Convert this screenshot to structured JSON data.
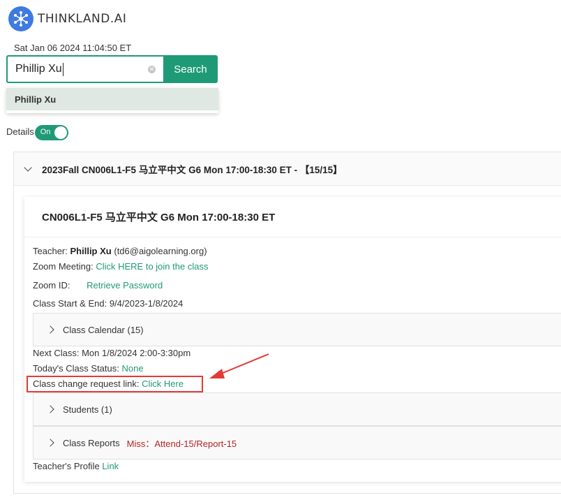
{
  "brand": {
    "name": "THINKLAND.AI",
    "logo_icon": "network-nodes-icon",
    "color": "#3f7ae0"
  },
  "datetime": "Sat Jan 06 2024 11:04:50 ET",
  "search": {
    "value": "Phillip Xu",
    "button_label": "Search",
    "clear_icon": "clear-icon",
    "accent": "#1f9a76"
  },
  "suggestion": {
    "item": "Phillip Xu"
  },
  "details": {
    "label": "Details",
    "toggle_label": "On",
    "state": true
  },
  "course": {
    "header": "2023Fall CN006L1-F5 马立平中文 G6 Mon 17:00-18:30 ET - 【15/15】",
    "title": "CN006L1-F5 马立平中文 G6 Mon 17:00-18:30 ET",
    "teacher_label": "Teacher:",
    "teacher_name": "Phillip Xu",
    "teacher_email": "(td6@aigolearning.org)",
    "zoom_meeting_label": "Zoom Meeting:",
    "zoom_meeting_link": "Click HERE to join the class",
    "zoom_id_label": "Zoom ID:",
    "zoom_id_link": "Retrieve Password",
    "start_end": "Class Start & End: 9/4/2023-1/8/2024",
    "calendar_label": "Class Calendar (15)",
    "next_class": "Next Class: Mon 1/8/2024 2:00-3:30pm",
    "today_status_label": "Today's Class Status:",
    "today_status_value": "None",
    "change_request_label": "Class change request link:",
    "change_request_link": "Click Here",
    "students_label": "Students (1)",
    "reports_label": "Class Reports",
    "reports_miss": "Miss：Attend-15/Report-15",
    "profile_label": "Teacher's Profile",
    "profile_link": "Link"
  },
  "colors": {
    "link": "#1f9a76",
    "miss": "#b4252a",
    "annotation": "#e53935"
  }
}
